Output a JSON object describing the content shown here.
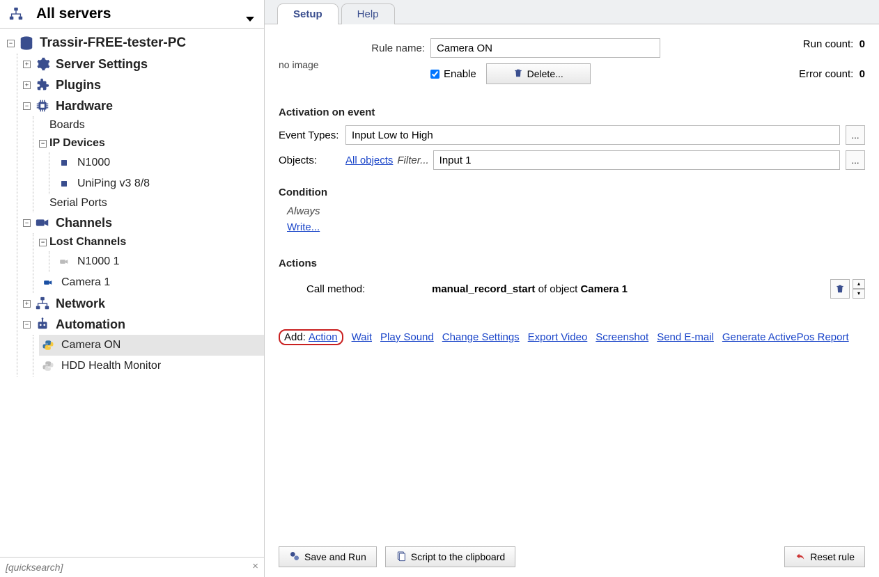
{
  "header": {
    "title": "All servers"
  },
  "tree": {
    "server": "Trassir-FREE-tester-PC",
    "server_settings": "Server Settings",
    "plugins": "Plugins",
    "hardware": "Hardware",
    "boards": "Boards",
    "ip_devices": "IP Devices",
    "dev_n1000": "N1000",
    "dev_uniping": "UniPing v3 8/8",
    "serial_ports": "Serial Ports",
    "channels": "Channels",
    "lost_channels": "Lost Channels",
    "ch_n1000": "N1000 1",
    "ch_camera1": "Camera 1",
    "network": "Network",
    "automation": "Automation",
    "auto_camera_on": "Camera ON",
    "auto_hdd": "HDD Health Monitor"
  },
  "search": {
    "placeholder": "[quicksearch]"
  },
  "tabs": {
    "setup": "Setup",
    "help": "Help"
  },
  "form": {
    "rule_name_label": "Rule name:",
    "rule_name_value": "Camera ON",
    "no_image": "no image",
    "enable": "Enable",
    "delete": "Delete...",
    "run_count_label": "Run count:",
    "run_count_value": "0",
    "error_count_label": "Error count:",
    "error_count_value": "0"
  },
  "activation": {
    "header": "Activation on event",
    "event_types_label": "Event Types:",
    "event_types_value": "Input Low to High",
    "objects_label": "Objects:",
    "all_objects": "All objects",
    "filter": "Filter...",
    "objects_value": "Input 1",
    "ellipsis": "..."
  },
  "condition": {
    "header": "Condition",
    "always": "Always",
    "write": "Write..."
  },
  "actions": {
    "header": "Actions",
    "call_method_label": "Call method:",
    "method_name": "manual_record_start",
    "of_object": " of object ",
    "object_name": "Camera 1",
    "add_label": "Add:",
    "links": {
      "action": "Action",
      "wait": "Wait",
      "playsound": "Play Sound",
      "change_settings": "Change Settings",
      "export_video": "Export Video",
      "screenshot": "Screenshot",
      "send_email": "Send E-mail",
      "generate_report": "Generate ActivePos Report"
    }
  },
  "bottom": {
    "save_run": "Save and Run",
    "script_clipboard": "Script to the clipboard",
    "reset": "Reset rule"
  }
}
